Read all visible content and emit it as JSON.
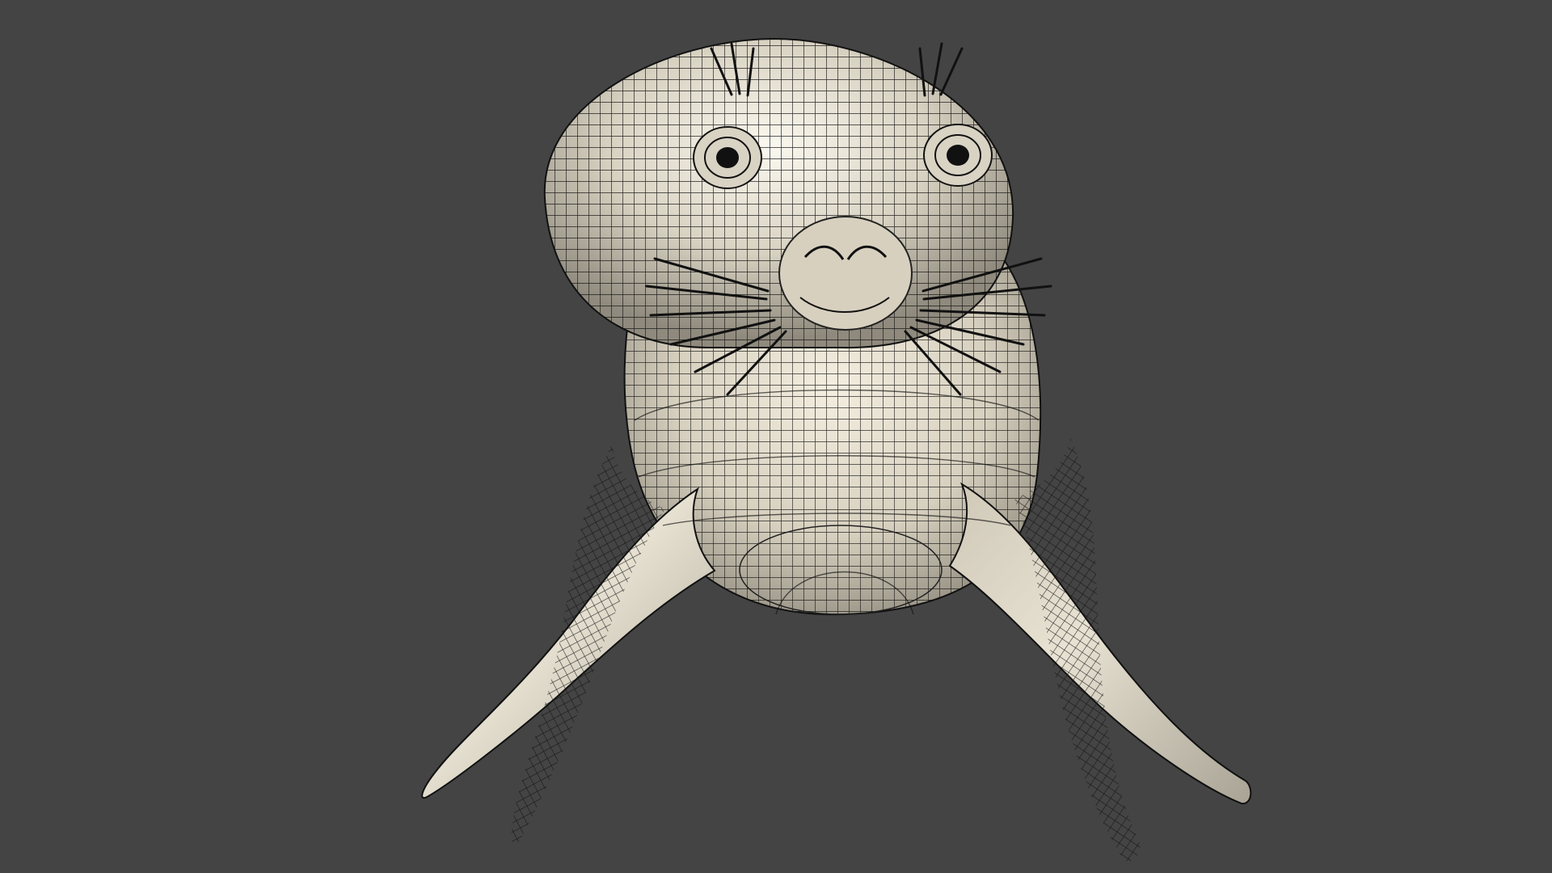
{
  "viewport": {
    "background_color": "#444444",
    "subject": "seal-wireframe-render",
    "mesh_line_color": "#111111",
    "surface_color": "#ded8c8",
    "shadow_color": "#8f8a7d"
  }
}
